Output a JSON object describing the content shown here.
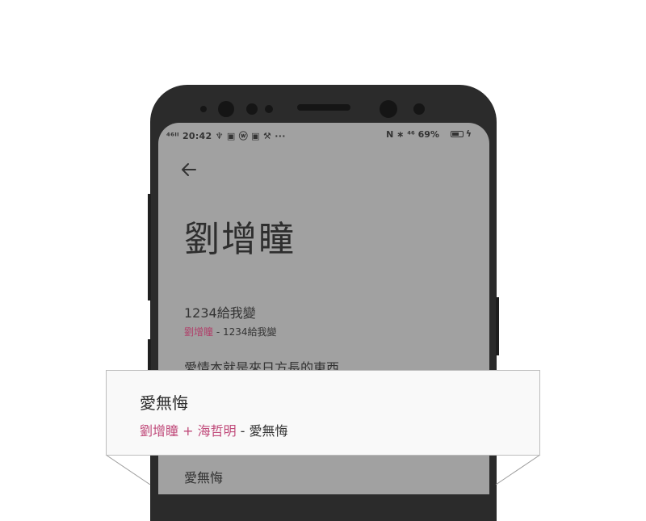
{
  "status_bar": {
    "left": "⁴⁶ᴵˡ 20:42 ♆ ▣ ⓦ ▣ ⚒ ···",
    "right": "N ∗ ⁴⁶ 69%",
    "battery_level": 0.69
  },
  "header": {
    "back_icon": "arrow-left-icon",
    "artist_name": "劉增瞳"
  },
  "songs": [
    {
      "title": "1234給我變",
      "artist": "劉增瞳",
      "separator": " - ",
      "subtitle_song": "1234給我變"
    },
    {
      "title": "愛情本就是來日方長的東西"
    },
    {
      "title": "愛無悔"
    }
  ],
  "popup": {
    "title": "愛無悔",
    "artist": "劉增瞳 + 海哲明",
    "separator": " - ",
    "song": "愛無悔"
  },
  "colors": {
    "screen_bg": "#a1a1a1",
    "accent": "#b0406a",
    "popup_bg": "#f9f9f9"
  }
}
